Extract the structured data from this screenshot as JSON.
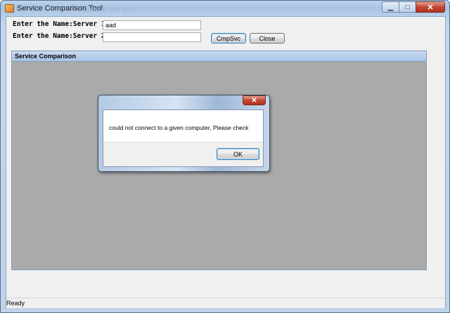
{
  "window": {
    "title": "Service Comparison Tool",
    "ghost_text": "Load all the form",
    "minimize_glyph": "▁",
    "maximize_glyph": "□",
    "close_glyph": "✕"
  },
  "form": {
    "server1_label": "Enter the Name:Server 1",
    "server1_value": "aad",
    "server2_label": "Enter the Name:Server 2",
    "server2_value": "",
    "compare_button": "CmpSvc",
    "close_button": "Close"
  },
  "group": {
    "header": "Service Comparison"
  },
  "dialog": {
    "close_glyph": "✕",
    "message": "could not connect to a given computer, Please check",
    "ok_button": "OK"
  },
  "statusbar": {
    "text": "Ready"
  },
  "colors": {
    "accent": "#3c7fb1",
    "close_red": "#c14834",
    "group_bg": "#aaaaaa"
  }
}
